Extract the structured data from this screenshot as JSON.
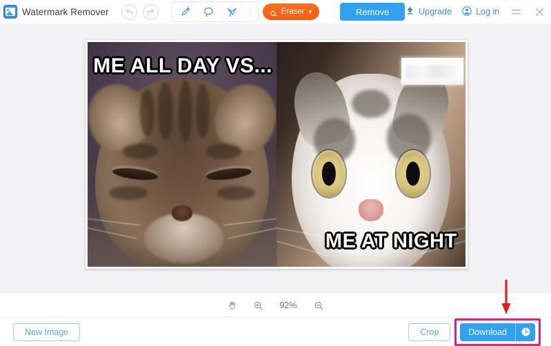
{
  "app": {
    "title": "Watermark Remover",
    "logo_icon": "photo-logo-icon"
  },
  "toolbar": {
    "undo_icon": "undo-icon",
    "redo_icon": "redo-icon",
    "tools": [
      {
        "icon": "brush-icon",
        "name": "brush-tool"
      },
      {
        "icon": "lasso-icon",
        "name": "lasso-tool"
      },
      {
        "icon": "polygon-icon",
        "name": "polygon-tool"
      }
    ],
    "eraser_label": "Eraser",
    "eraser_icon": "eraser-icon",
    "eraser_caret": "⌄",
    "remove_label": "Remove",
    "upgrade_label": "Upgrade",
    "upgrade_icon": "upload-arrow-icon",
    "login_label": "Log in",
    "login_icon": "user-circle-icon",
    "menu_icon": "hamburger-menu-icon",
    "close_icon": "close-icon"
  },
  "canvas": {
    "image": {
      "caption_top": "ME ALL DAY VS...",
      "caption_bottom": "ME AT NIGHT",
      "left_panel_name": "sleeping-kitten-photo",
      "right_panel_name": "wide-eyed-cat-photo",
      "watermark_patch_name": "removed-watermark-area"
    }
  },
  "zoombar": {
    "pan_icon": "hand-pan-icon",
    "zoom_in_icon": "zoom-in-icon",
    "zoom_level": "92%",
    "zoom_out_icon": "zoom-out-icon"
  },
  "bottombar": {
    "new_image_label": "New Image",
    "crop_label": "Crop",
    "download_label": "Download",
    "download_history_icon": "clock-history-icon"
  },
  "annotations": {
    "arrow_name": "red-down-arrow",
    "arrow_color": "#e02020",
    "highlight_name": "download-highlight-box",
    "highlight_color": "#ec1c7d"
  },
  "colors": {
    "primary_blue": "#31a2f2",
    "accent_orange": "#f35f12",
    "link_blue": "#3c8ee8",
    "canvas_bg": "#f2f2f4"
  }
}
